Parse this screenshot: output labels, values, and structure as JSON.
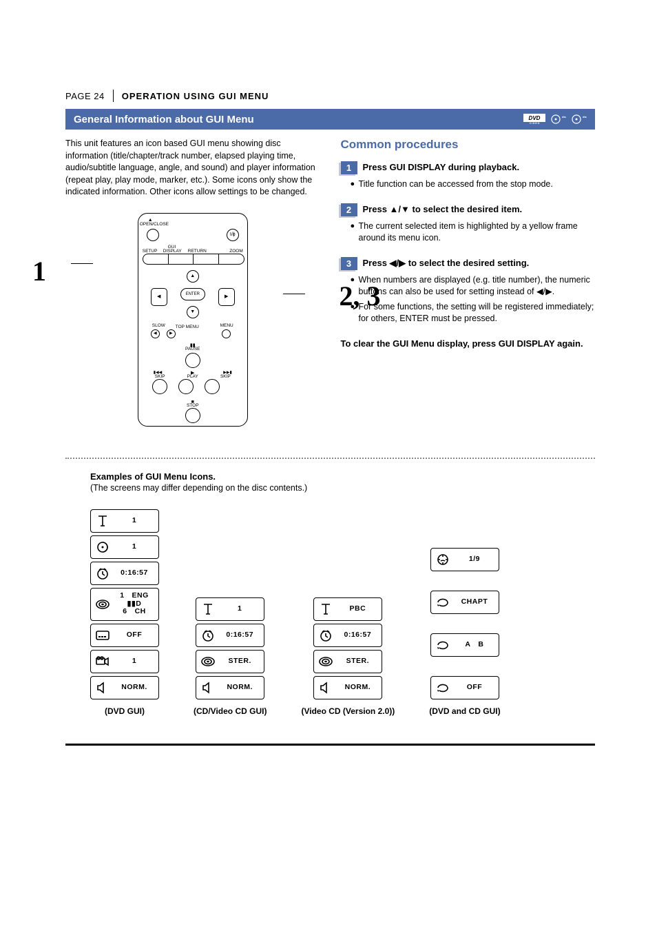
{
  "header": {
    "page_label": "PAGE 24",
    "section_title": "OPERATION USING GUI MENU"
  },
  "heading_bar": "General Information about GUI Menu",
  "intro_paragraph": "This unit features an icon based GUI menu showing disc information (title/chapter/track number, elapsed playing time, audio/subtitle language, angle, and sound) and player information (repeat play, play mode, marker, etc.). Some icons only show the indicated information. Other icons allow settings to be changed.",
  "remote": {
    "callout_1": "1",
    "callout_23": "2, 3",
    "labels": {
      "open_close": "OPEN/CLOSE",
      "power": "I/ɸ",
      "setup": "SETUP",
      "gui": "GUI",
      "display": "DISPLAY",
      "return": "RETURN",
      "zoom": "ZOOM",
      "enter": "ENTER",
      "slow": "SLOW",
      "top_menu": "TOP MENU",
      "menu": "MENU",
      "pause": "PAUSE",
      "skip_prev": "SKIP",
      "play": "PLAY",
      "skip_next": "SKIP",
      "stop": "STOP"
    }
  },
  "common_procedures": {
    "heading": "Common procedures",
    "steps": [
      {
        "num": "1",
        "text": "Press GUI DISPLAY during playback.",
        "bullets": [
          "Title function can be accessed from the stop mode."
        ]
      },
      {
        "num": "2",
        "text": "Press ▲/▼ to select the desired item.",
        "bullets": [
          "The current selected item is highlighted by a yellow frame around its menu icon."
        ]
      },
      {
        "num": "3",
        "text": "Press ◀/▶ to select the desired setting.",
        "bullets": [
          "When numbers are displayed (e.g. title number), the numeric buttons can also be used for setting instead of ◀/▶.",
          "For some functions, the setting will be registered immediately; for others, ENTER must be pressed."
        ]
      }
    ],
    "clear_text": "To clear the GUI Menu display, press GUI DISPLAY again."
  },
  "examples": {
    "title": "Examples of GUI Menu Icons.",
    "subtitle": "(The screens may differ depending on the disc contents.)",
    "columns": [
      {
        "label": "(DVD GUI)",
        "items": [
          {
            "icon": "title",
            "value": "1"
          },
          {
            "icon": "chapter",
            "value": "1"
          },
          {
            "icon": "clock",
            "value": "0:16:57"
          },
          {
            "icon": "audio",
            "value": "1 ENG\n▮▮D\n6 CH",
            "tall": true
          },
          {
            "icon": "subtitle",
            "value": "OFF"
          },
          {
            "icon": "angle",
            "value": "1"
          },
          {
            "icon": "sound",
            "value": "NORM."
          }
        ]
      },
      {
        "label": "(CD/Video CD GUI)",
        "items": [
          {
            "icon": "title",
            "value": "1"
          },
          {
            "icon": "clock",
            "value": "0:16:57"
          },
          {
            "icon": "audio",
            "value": "STER."
          },
          {
            "icon": "sound",
            "value": "NORM."
          }
        ]
      },
      {
        "label": "(Video CD (Version 2.0))",
        "items": [
          {
            "icon": "title",
            "value": "PBC"
          },
          {
            "icon": "clock",
            "value": "0:16:57"
          },
          {
            "icon": "audio",
            "value": "STER."
          },
          {
            "icon": "sound",
            "value": "NORM."
          }
        ]
      },
      {
        "label": "(DVD and CD GUI)",
        "items": [
          {
            "icon": "marker",
            "value": "1/9"
          },
          {
            "icon": "repeat",
            "value": "CHAPT"
          },
          {
            "icon": "repeat",
            "value": "A B"
          },
          {
            "icon": "repeat",
            "value": "OFF"
          }
        ]
      }
    ]
  }
}
